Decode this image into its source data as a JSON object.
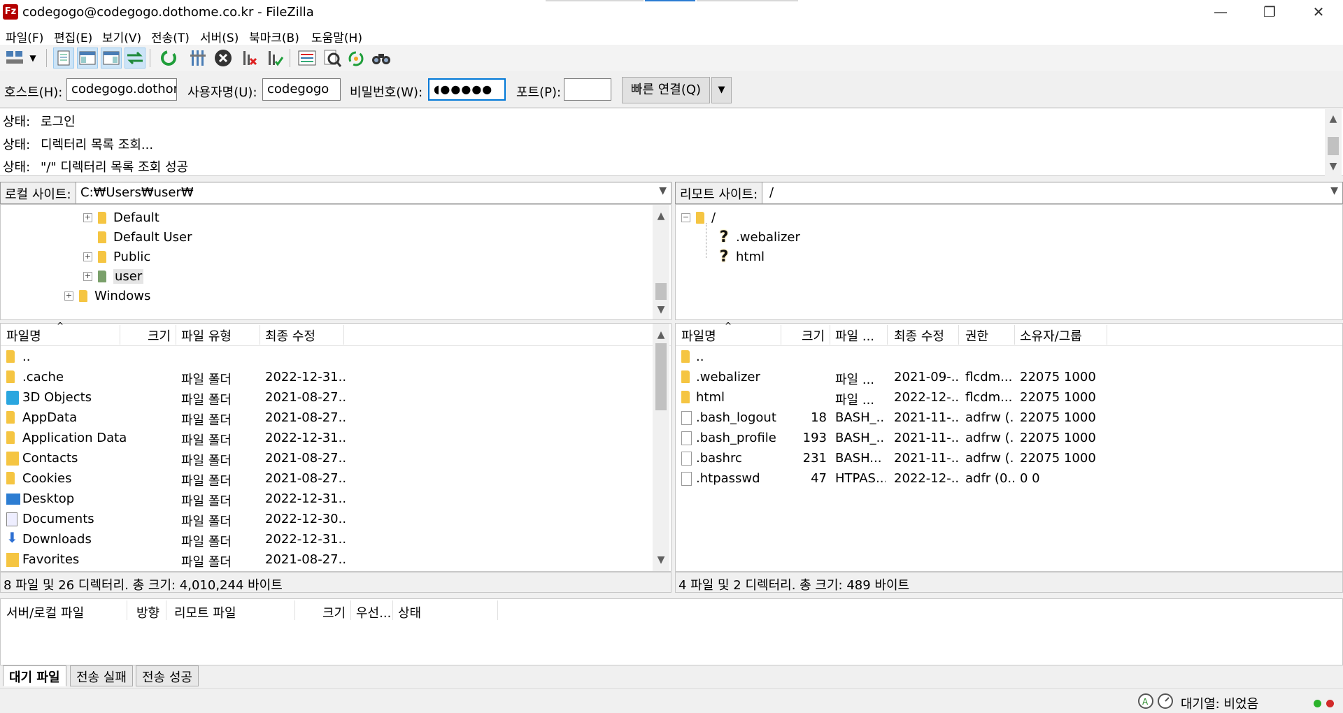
{
  "window": {
    "title": "codegogo@codegogo.dothome.co.kr - FileZilla",
    "app_icon": "filezilla-icon",
    "controls": {
      "minimize": "—",
      "restore": "❐",
      "close": "✕"
    }
  },
  "menu": [
    "파일(F)",
    "편집(E)",
    "보기(V)",
    "전송(T)",
    "서버(S)",
    "북마크(B)",
    "도움말(H)"
  ],
  "toolbar": {
    "icons": [
      "site-manager-icon",
      "dropdown-icon",
      "toggle-log-icon",
      "toggle-local-tree-icon",
      "toggle-remote-tree-icon",
      "toggle-queue-icon",
      "refresh-icon",
      "process-queue-icon",
      "cancel-icon",
      "disconnect-icon",
      "reconnect-icon",
      "directory-compare-icon",
      "filter-icon",
      "sync-browse-icon",
      "search-icon"
    ]
  },
  "quickconnect": {
    "host_label": "호스트(H):",
    "host_value": "codegogo.dothon",
    "user_label": "사용자명(U):",
    "user_value": "codegogo",
    "pass_label": "비밀번호(W):",
    "pass_value": "◖●●●●●",
    "port_label": "포트(P):",
    "port_value": "",
    "connect_label": "빠른 연결(Q)",
    "dropdown": "▼"
  },
  "log": [
    {
      "label": "상태:",
      "text": "로그인"
    },
    {
      "label": "상태:",
      "text": "디렉터리 목록 조회..."
    },
    {
      "label": "상태:",
      "text": "\"/\" 디렉터리 목록 조회 성공"
    }
  ],
  "local": {
    "site_label": "로컬 사이트:",
    "path": "C:₩Users₩user₩",
    "tree": [
      {
        "name": "Default",
        "expander": "+",
        "indent": 2
      },
      {
        "name": "Default User",
        "expander": "",
        "indent": 2
      },
      {
        "name": "Public",
        "expander": "+",
        "indent": 2
      },
      {
        "name": "user",
        "expander": "+",
        "indent": 2
      },
      {
        "name": "Windows",
        "expander": "+",
        "indent": 1
      }
    ],
    "columns": [
      "파일명",
      "크기",
      "파일 유형",
      "최종 수정"
    ],
    "files": [
      {
        "name": "..",
        "size": "",
        "type": "",
        "modified": "",
        "icon": "folder-icon"
      },
      {
        "name": ".cache",
        "size": "",
        "type": "파일 폴더",
        "modified": "2022-12-31...",
        "icon": "folder-icon"
      },
      {
        "name": "3D Objects",
        "size": "",
        "type": "파일 폴더",
        "modified": "2021-08-27...",
        "icon": "3d-objects-icon"
      },
      {
        "name": "AppData",
        "size": "",
        "type": "파일 폴더",
        "modified": "2021-08-27...",
        "icon": "folder-icon"
      },
      {
        "name": "Application Data",
        "size": "",
        "type": "파일 폴더",
        "modified": "2022-12-31...",
        "icon": "folder-icon"
      },
      {
        "name": "Contacts",
        "size": "",
        "type": "파일 폴더",
        "modified": "2021-08-27...",
        "icon": "contacts-icon"
      },
      {
        "name": "Cookies",
        "size": "",
        "type": "파일 폴더",
        "modified": "2021-08-27...",
        "icon": "folder-icon"
      },
      {
        "name": "Desktop",
        "size": "",
        "type": "파일 폴더",
        "modified": "2022-12-31...",
        "icon": "desktop-icon"
      },
      {
        "name": "Documents",
        "size": "",
        "type": "파일 폴더",
        "modified": "2022-12-30...",
        "icon": "documents-icon"
      },
      {
        "name": "Downloads",
        "size": "",
        "type": "파일 폴더",
        "modified": "2022-12-31...",
        "icon": "downloads-icon"
      },
      {
        "name": "Favorites",
        "size": "",
        "type": "파일 폴더",
        "modified": "2021-08-27...",
        "icon": "favorites-icon"
      }
    ],
    "status": "8 파일 및 26 디렉터리. 총 크기: 4,010,244 바이트"
  },
  "remote": {
    "site_label": "리모트 사이트:",
    "path": "/",
    "tree": [
      {
        "name": "/",
        "expander": "−",
        "icon": "folder-icon"
      },
      {
        "name": ".webalizer",
        "expander": "",
        "icon": "unknown-icon"
      },
      {
        "name": "html",
        "expander": "",
        "icon": "unknown-icon"
      }
    ],
    "columns": [
      "파일명",
      "크기",
      "파일 ...",
      "최종 수정",
      "권한",
      "소유자/그룹"
    ],
    "files": [
      {
        "name": "..",
        "size": "",
        "type": "",
        "modified": "",
        "perms": "",
        "owner": "",
        "icon": "folder-icon"
      },
      {
        "name": ".webalizer",
        "size": "",
        "type": "파일 ...",
        "modified": "2021-09-...",
        "perms": "flcdm...",
        "owner": "22075 1000",
        "icon": "folder-icon"
      },
      {
        "name": "html",
        "size": "",
        "type": "파일 ...",
        "modified": "2022-12-...",
        "perms": "flcdm...",
        "owner": "22075 1000",
        "icon": "folder-icon"
      },
      {
        "name": ".bash_logout",
        "size": "18",
        "type": "BASH_...",
        "modified": "2021-11-...",
        "perms": "adfrw (...",
        "owner": "22075 1000",
        "icon": "file-icon"
      },
      {
        "name": ".bash_profile",
        "size": "193",
        "type": "BASH_...",
        "modified": "2021-11-...",
        "perms": "adfrw (...",
        "owner": "22075 1000",
        "icon": "file-icon"
      },
      {
        "name": ".bashrc",
        "size": "231",
        "type": "BASH...",
        "modified": "2021-11-...",
        "perms": "adfrw (...",
        "owner": "22075 1000",
        "icon": "file-icon"
      },
      {
        "name": ".htpasswd",
        "size": "47",
        "type": "HTPAS...",
        "modified": "2022-12-...",
        "perms": "adfr (0...",
        "owner": "0 0",
        "icon": "file-icon"
      }
    ],
    "status": "4 파일 및 2 디렉터리. 총 크기: 489 바이트"
  },
  "queue": {
    "columns": [
      "서버/로컬 파일",
      "방향",
      "리모트 파일",
      "크기",
      "우선...",
      "상태"
    ]
  },
  "tabs": [
    "대기 파일",
    "전송 실패",
    "전송 성공"
  ],
  "statusbar": {
    "queue_text": "대기열: 비었음",
    "icons": [
      "autotype-icon",
      "speed-limit-icon"
    ],
    "led_colors": [
      "#2bb32b",
      "#d12a2a"
    ]
  },
  "colors": {
    "folder": "#f5c542",
    "accent": "#0078d7",
    "background": "#f0f0f0"
  }
}
